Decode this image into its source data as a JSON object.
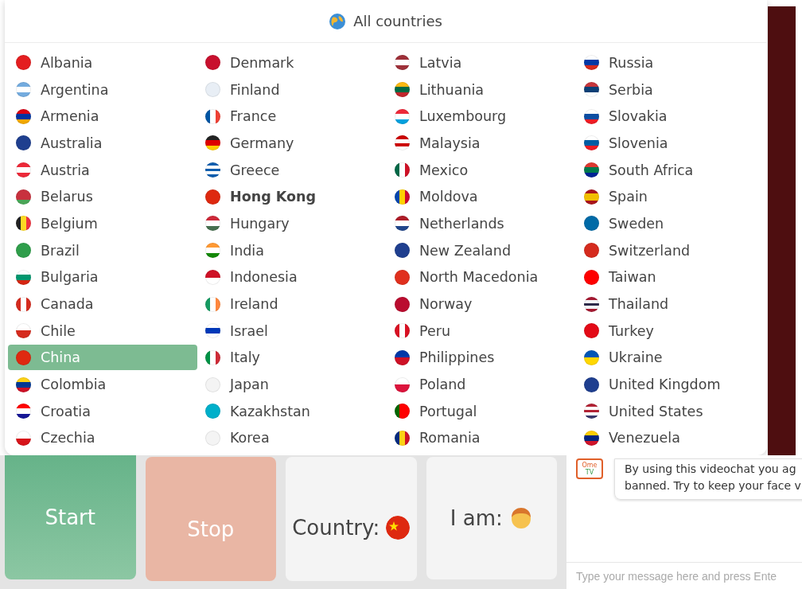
{
  "dialog": {
    "title": "All countries",
    "countries": [
      {
        "name": "Albania",
        "selected": false,
        "hovered": false
      },
      {
        "name": "Argentina",
        "selected": false,
        "hovered": false
      },
      {
        "name": "Armenia",
        "selected": false,
        "hovered": false
      },
      {
        "name": "Australia",
        "selected": false,
        "hovered": false
      },
      {
        "name": "Austria",
        "selected": false,
        "hovered": false
      },
      {
        "name": "Belarus",
        "selected": false,
        "hovered": false
      },
      {
        "name": "Belgium",
        "selected": false,
        "hovered": false
      },
      {
        "name": "Brazil",
        "selected": false,
        "hovered": false
      },
      {
        "name": "Bulgaria",
        "selected": false,
        "hovered": false
      },
      {
        "name": "Canada",
        "selected": false,
        "hovered": false
      },
      {
        "name": "Chile",
        "selected": false,
        "hovered": false
      },
      {
        "name": "China",
        "selected": true,
        "hovered": false
      },
      {
        "name": "Colombia",
        "selected": false,
        "hovered": false
      },
      {
        "name": "Croatia",
        "selected": false,
        "hovered": false
      },
      {
        "name": "Czechia",
        "selected": false,
        "hovered": false
      },
      {
        "name": "Denmark",
        "selected": false,
        "hovered": false
      },
      {
        "name": "Finland",
        "selected": false,
        "hovered": false
      },
      {
        "name": "France",
        "selected": false,
        "hovered": false
      },
      {
        "name": "Germany",
        "selected": false,
        "hovered": false
      },
      {
        "name": "Greece",
        "selected": false,
        "hovered": false
      },
      {
        "name": "Hong Kong",
        "selected": false,
        "hovered": true
      },
      {
        "name": "Hungary",
        "selected": false,
        "hovered": false
      },
      {
        "name": "India",
        "selected": false,
        "hovered": false
      },
      {
        "name": "Indonesia",
        "selected": false,
        "hovered": false
      },
      {
        "name": "Ireland",
        "selected": false,
        "hovered": false
      },
      {
        "name": "Israel",
        "selected": false,
        "hovered": false
      },
      {
        "name": "Italy",
        "selected": false,
        "hovered": false
      },
      {
        "name": "Japan",
        "selected": false,
        "hovered": false
      },
      {
        "name": "Kazakhstan",
        "selected": false,
        "hovered": false
      },
      {
        "name": "Korea",
        "selected": false,
        "hovered": false
      },
      {
        "name": "Latvia",
        "selected": false,
        "hovered": false
      },
      {
        "name": "Lithuania",
        "selected": false,
        "hovered": false
      },
      {
        "name": "Luxembourg",
        "selected": false,
        "hovered": false
      },
      {
        "name": "Malaysia",
        "selected": false,
        "hovered": false
      },
      {
        "name": "Mexico",
        "selected": false,
        "hovered": false
      },
      {
        "name": "Moldova",
        "selected": false,
        "hovered": false
      },
      {
        "name": "Netherlands",
        "selected": false,
        "hovered": false
      },
      {
        "name": "New Zealand",
        "selected": false,
        "hovered": false
      },
      {
        "name": "North Macedonia",
        "selected": false,
        "hovered": false
      },
      {
        "name": "Norway",
        "selected": false,
        "hovered": false
      },
      {
        "name": "Peru",
        "selected": false,
        "hovered": false
      },
      {
        "name": "Philippines",
        "selected": false,
        "hovered": false
      },
      {
        "name": "Poland",
        "selected": false,
        "hovered": false
      },
      {
        "name": "Portugal",
        "selected": false,
        "hovered": false
      },
      {
        "name": "Romania",
        "selected": false,
        "hovered": false
      },
      {
        "name": "Russia",
        "selected": false,
        "hovered": false
      },
      {
        "name": "Serbia",
        "selected": false,
        "hovered": false
      },
      {
        "name": "Slovakia",
        "selected": false,
        "hovered": false
      },
      {
        "name": "Slovenia",
        "selected": false,
        "hovered": false
      },
      {
        "name": "South Africa",
        "selected": false,
        "hovered": false
      },
      {
        "name": "Spain",
        "selected": false,
        "hovered": false
      },
      {
        "name": "Sweden",
        "selected": false,
        "hovered": false
      },
      {
        "name": "Switzerland",
        "selected": false,
        "hovered": false
      },
      {
        "name": "Taiwan",
        "selected": false,
        "hovered": false
      },
      {
        "name": "Thailand",
        "selected": false,
        "hovered": false
      },
      {
        "name": "Turkey",
        "selected": false,
        "hovered": false
      },
      {
        "name": "Ukraine",
        "selected": false,
        "hovered": false
      },
      {
        "name": "United Kingdom",
        "selected": false,
        "hovered": false
      },
      {
        "name": "United States",
        "selected": false,
        "hovered": false
      },
      {
        "name": "Venezuela",
        "selected": false,
        "hovered": false
      }
    ]
  },
  "controls": {
    "start": "Start",
    "stop": "Stop",
    "country_label": "Country:",
    "gender_label": "I am:"
  },
  "chat": {
    "logo_top": "Ome",
    "logo_bottom": "TV",
    "notice_lines": [
      "By using this videochat you ag",
      "banned. Try to keep your face v"
    ],
    "input_placeholder": "Type your message here and press Ente"
  }
}
